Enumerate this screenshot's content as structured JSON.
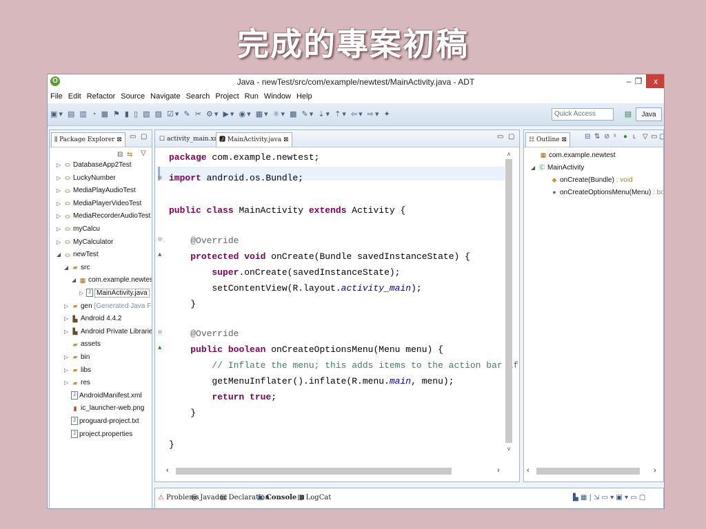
{
  "slide": {
    "title": "完成的專案初稿"
  },
  "window": {
    "title": "Java - newTest/src/com/example/newtest/MainActivity.java - ADT",
    "app_icon": "O",
    "min": "–",
    "max": "❐",
    "close": "x"
  },
  "menu": [
    "File",
    "Edit",
    "Refactor",
    "Source",
    "Navigate",
    "Search",
    "Project",
    "Run",
    "Window",
    "Help"
  ],
  "toolbar": {
    "quick_access_placeholder": "Quick Access",
    "perspective_label": "Java",
    "icons": "▣▾ ▤ ▥ ◔ ▦ ⚑ ▮ ▯ ▧ ▨ ☑▾ ✎ ✂ ⚙▾ ▶▾ ◉▾ ▦▾ ⚛▾ ▩ ✎▾ ⇣▾ ⇡▾ ⇦▾ ⇨▾ ✦"
  },
  "package_explorer": {
    "tab_label": "Package Explorer",
    "tab_close": "⊠",
    "items": [
      {
        "label": "DatabaseApp2Test",
        "depth": 0,
        "twisty": "▷",
        "icon": "proj"
      },
      {
        "label": "LuckyNumber",
        "depth": 0,
        "twisty": "▷",
        "icon": "proj"
      },
      {
        "label": "MediaPlayAudioTest",
        "depth": 0,
        "twisty": "▷",
        "icon": "proj"
      },
      {
        "label": "MediaPlayerVideoTest",
        "depth": 0,
        "twisty": "▷",
        "icon": "proj"
      },
      {
        "label": "MediaRecorderAudioTest",
        "depth": 0,
        "twisty": "▷",
        "icon": "proj"
      },
      {
        "label": "myCalcu",
        "depth": 0,
        "twisty": "▷",
        "icon": "proj"
      },
      {
        "label": "MyCalculator",
        "depth": 0,
        "twisty": "▷",
        "icon": "proj"
      },
      {
        "label": "newTest",
        "depth": 0,
        "twisty": "◢",
        "icon": "proj"
      },
      {
        "label": "src",
        "depth": 1,
        "twisty": "◢",
        "icon": "folder"
      },
      {
        "label": "com.example.newtest",
        "depth": 2,
        "twisty": "◢",
        "icon": "pkg"
      },
      {
        "label": "MainActivity.java",
        "depth": 3,
        "twisty": "▷",
        "icon": "file",
        "selected": true
      },
      {
        "label": "gen",
        "extra": "[Generated Java Files]",
        "depth": 1,
        "twisty": "▷",
        "icon": "gen"
      },
      {
        "label": "Android 4.4.2",
        "depth": 1,
        "twisty": "▷",
        "icon": "lib"
      },
      {
        "label": "Android Private Libraries",
        "depth": 1,
        "twisty": "▷",
        "icon": "lib"
      },
      {
        "label": "assets",
        "depth": 1,
        "twisty": "",
        "icon": "folder"
      },
      {
        "label": "bin",
        "depth": 1,
        "twisty": "▷",
        "icon": "folder"
      },
      {
        "label": "libs",
        "depth": 1,
        "twisty": "▷",
        "icon": "folder"
      },
      {
        "label": "res",
        "depth": 1,
        "twisty": "▷",
        "icon": "folder"
      },
      {
        "label": "AndroidManifest.xml",
        "depth": 1,
        "twisty": "",
        "icon": "file"
      },
      {
        "label": "ic_launcher-web.png",
        "depth": 1,
        "twisty": "",
        "icon": "img"
      },
      {
        "label": "proguard-project.txt",
        "depth": 1,
        "twisty": "",
        "icon": "file"
      },
      {
        "label": "project.properties",
        "depth": 1,
        "twisty": "",
        "icon": "file"
      }
    ]
  },
  "editor": {
    "tabs": [
      {
        "label": "activity_main.xml",
        "active": false
      },
      {
        "label": "MainActivity.java",
        "active": true,
        "close": "⊠"
      }
    ],
    "code": {
      "l1_kw": "package",
      "l1_rest": " com.example.newtest;",
      "l2_kw": "import",
      "l2_rest": " android.os.Bundle;",
      "l3_kw1": "public",
      "l3_kw2": "class",
      "l3_mid": " MainActivity ",
      "l3_kw3": "extends",
      "l3_rest": " Activity {",
      "l4_an": "@Override",
      "l5_kw1": "protected",
      "l5_kw2": "void",
      "l5_rest": " onCreate(Bundle savedInstanceState) {",
      "l6_kw": "super",
      "l6_rest": ".onCreate(savedInstanceState);",
      "l7_a": "setContentView(R.layout.",
      "l7_it": "activity_main",
      "l7_b": ");",
      "l8": "}",
      "l9_an": "@Override",
      "l10_kw1": "public",
      "l10_kw2": "boolean",
      "l10_rest": " onCreateOptionsMenu(Menu menu) {",
      "l11_cm": "// Inflate the menu; this adds items to the action bar if i",
      "l12_a": "getMenuInflater().inflate(R.menu.",
      "l12_it": "main",
      "l12_b": ", menu);",
      "l13_kw1": "return",
      "l13_kw2": "true",
      "l13_rest": ";",
      "l14": "}",
      "l15": "}"
    }
  },
  "outline": {
    "tab_label": "Outline",
    "tab_close": "⊠",
    "package": "com.example.newtest",
    "class": "MainActivity",
    "methods": [
      {
        "name": "onCreate(Bundle)",
        "ret": " : void"
      },
      {
        "name": "onCreateOptionsMenu(Menu)",
        "ret": " : boole"
      }
    ]
  },
  "console": {
    "tabs": [
      {
        "label": "Problems",
        "active": false
      },
      {
        "label": "Javadoc",
        "active": false
      },
      {
        "label": "Declaration",
        "active": false
      },
      {
        "label": "Console",
        "active": true,
        "close": "⊠"
      },
      {
        "label": "LogCat",
        "active": false
      }
    ]
  }
}
